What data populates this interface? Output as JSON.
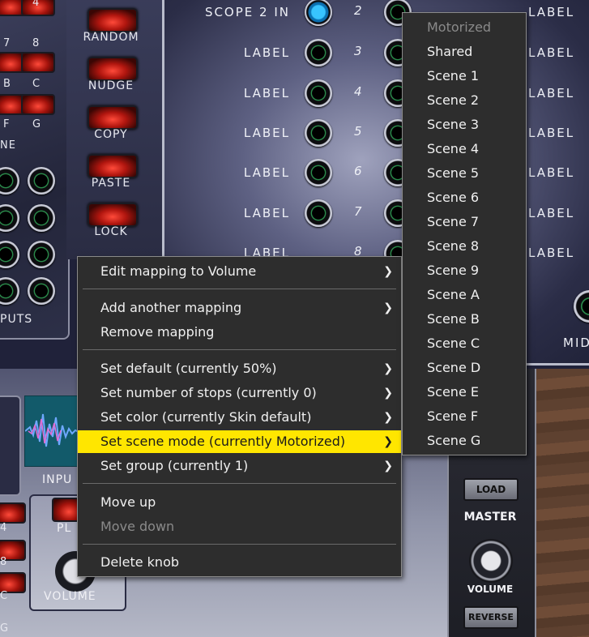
{
  "rack": {
    "left_buttons": [
      "RANDOM",
      "NUDGE",
      "COPY",
      "PASTE",
      "LOCK"
    ],
    "small_pad_labels": [
      "4",
      "7",
      "8",
      "B",
      "C",
      "F",
      "G"
    ],
    "partial_label_ne": "NE",
    "outputs_label": "PUTS",
    "scope_rows": [
      {
        "label": "SCOPE 2 IN",
        "num": "2",
        "right": "LABEL"
      },
      {
        "label": "LABEL",
        "num": "3",
        "right": "LABEL"
      },
      {
        "label": "LABEL",
        "num": "4",
        "right": "LABEL"
      },
      {
        "label": "LABEL",
        "num": "5",
        "right": "LABEL"
      },
      {
        "label": "LABEL",
        "num": "6",
        "right": "LABEL"
      },
      {
        "label": "LABEL",
        "num": "7",
        "right": "LABEL"
      },
      {
        "label": "LABEL",
        "num": "8",
        "right": "LABEL"
      }
    ],
    "mid_label": "MID",
    "bottom": {
      "input_label": "INPU",
      "pl_label": "PL",
      "volume_label": "VOLUME",
      "left_pads": [
        "4",
        "8",
        "C",
        "G"
      ]
    },
    "master": {
      "load": "LOAD",
      "title": "MASTER",
      "volume": "VOLUME",
      "reverse": "REVERSE"
    }
  },
  "context_menu": {
    "items": [
      {
        "label": "Edit mapping to Volume",
        "submenu": true
      },
      {
        "label": "Add another mapping",
        "submenu": true
      },
      {
        "label": "Remove mapping",
        "submenu": false
      },
      {
        "label": "Set default (currently 50%)",
        "submenu": true
      },
      {
        "label": "Set number of stops (currently 0)",
        "submenu": true
      },
      {
        "label": "Set color (currently Skin default)",
        "submenu": true
      },
      {
        "label": "Set scene mode (currently Motorized)",
        "submenu": true,
        "highlighted": true
      },
      {
        "label": "Set group (currently 1)",
        "submenu": true
      },
      {
        "label": "Move up",
        "submenu": false
      },
      {
        "label": "Move down",
        "submenu": false,
        "disabled": true
      },
      {
        "label": "Delete knob",
        "submenu": false
      }
    ],
    "highlight_color": "#ffe600"
  },
  "scene_submenu": {
    "items": [
      "Motorized",
      "Shared",
      "Scene 1",
      "Scene 2",
      "Scene 3",
      "Scene 4",
      "Scene 5",
      "Scene 6",
      "Scene 7",
      "Scene 8",
      "Scene 9",
      "Scene A",
      "Scene B",
      "Scene C",
      "Scene D",
      "Scene E",
      "Scene F",
      "Scene G"
    ],
    "disabled_item": "Motorized"
  },
  "icons": {
    "submenu_arrow": "chevron-right-icon"
  }
}
